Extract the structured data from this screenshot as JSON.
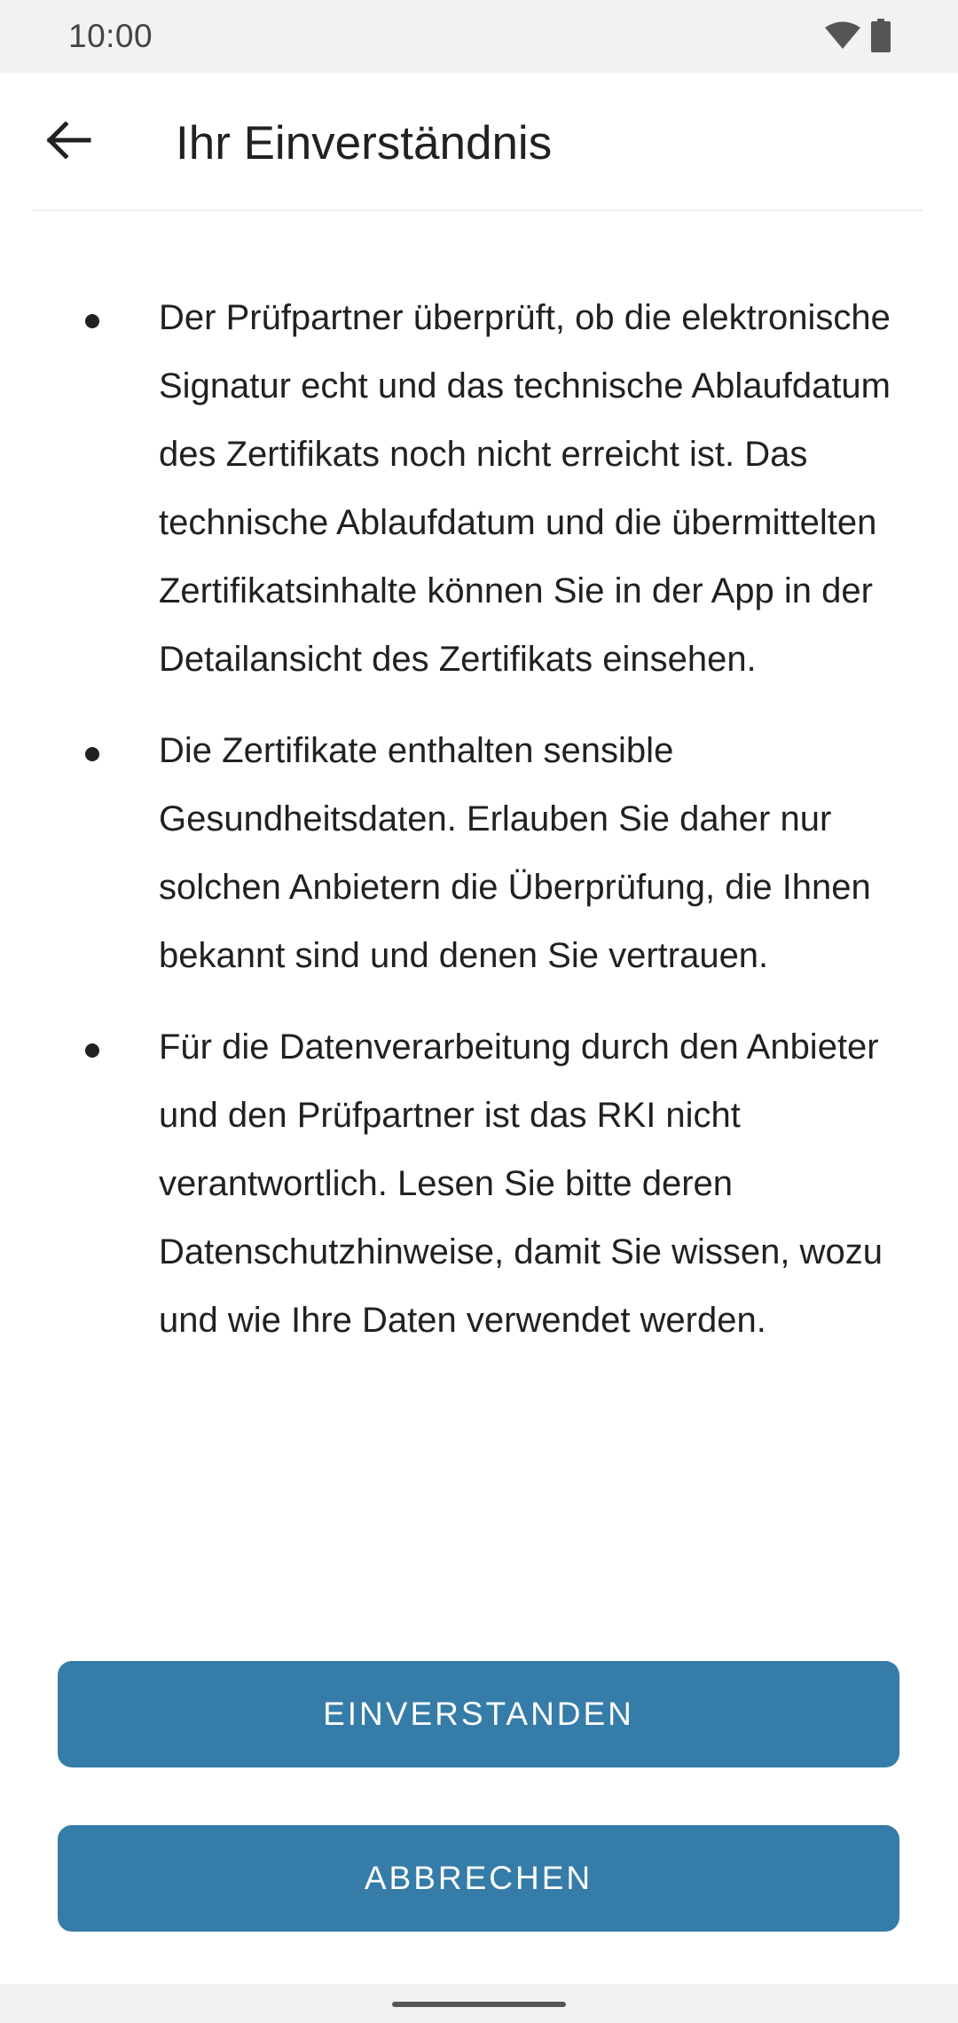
{
  "status_bar": {
    "time": "10:00",
    "icons": [
      "wifi-icon",
      "battery-icon"
    ]
  },
  "app_bar": {
    "back_icon": "arrow-back-icon",
    "title": "Ihr Einverständnis"
  },
  "content": {
    "bullets": [
      "Der Prüfpartner überprüft, ob die elektronische Signatur echt und das technische Ablaufdatum des Zertifikats noch nicht erreicht ist. Das technische Ablaufdatum und die übermittelten Zertifikatsinhalte können Sie in der App in der Detailansicht des Zertifikats einsehen.",
      "Die Zertifikate enthalten sensible Gesundheitsdaten. Erlauben Sie daher nur solchen Anbietern die Überprüfung, die Ihnen bekannt sind und denen Sie vertrauen.",
      "Für die Datenverarbeitung durch den Anbieter und den Prüfpartner ist das RKI nicht verantwortlich. Lesen Sie bitte deren Datenschutzhinweise, damit Sie wissen, wozu und wie Ihre Daten verwendet werden."
    ]
  },
  "actions": {
    "agree_label": "EINVERSTANDEN",
    "cancel_label": "ABBRECHEN",
    "button_color": "#357ca8"
  }
}
